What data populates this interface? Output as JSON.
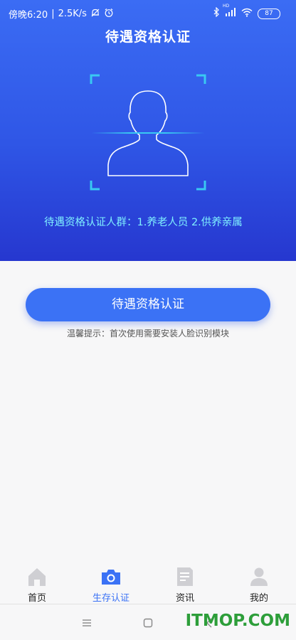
{
  "status_bar": {
    "time_text": "傍晚6:20",
    "speed_text": "2.5K/s",
    "battery": "87",
    "network_label": "HD"
  },
  "header": {
    "title": "待遇资格认证"
  },
  "face_frame": {
    "icon": "face-silhouette-icon",
    "accent_color": "#39c9f2"
  },
  "notice": {
    "text": "待遇资格认证人群：1.养老人员    2.供养亲属"
  },
  "primary_action": {
    "label": "待遇资格认证",
    "color": "#3b72f5"
  },
  "hint": {
    "text": "温馨提示：首次使用需要安装人脸识别模块"
  },
  "tabs": [
    {
      "label": "首页",
      "icon": "home-icon",
      "active": false
    },
    {
      "label": "生存认证",
      "icon": "camera-icon",
      "active": true
    },
    {
      "label": "资讯",
      "icon": "document-icon",
      "active": false
    },
    {
      "label": "我的",
      "icon": "user-icon",
      "active": false
    }
  ],
  "watermark": {
    "text": "ITMOP.COM",
    "color": "#2d9e3a"
  }
}
